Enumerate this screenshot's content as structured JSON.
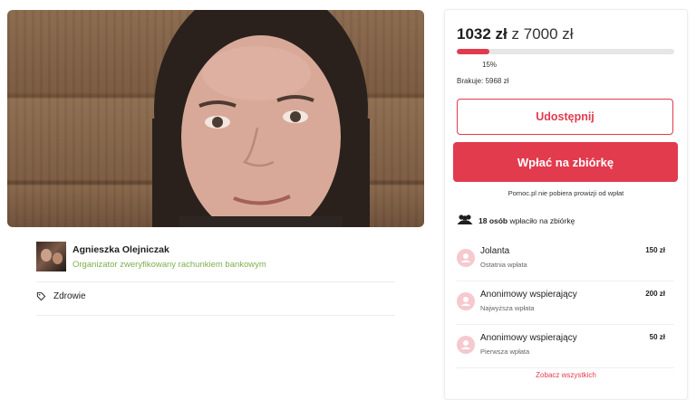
{
  "organizer": {
    "name": "Agnieszka Olejniczak",
    "subtitle": "Organizator zweryfikowany rachunkiem bankowym"
  },
  "category": {
    "label": "Zdrowie",
    "icon": "tag-icon"
  },
  "fundraiser": {
    "raised": "1032 zł",
    "separator": "z",
    "goal": "7000 zł",
    "progress_percent": 15,
    "progress_label": "15%",
    "missing": "Brakuje: 5968 zł"
  },
  "actions": {
    "share_label": "Udostępnij",
    "donate_label": "Wpłać na zbiórkę"
  },
  "fee_note": "Pomoc.pl nie pobiera prowizji od wpłat",
  "donors_summary": {
    "count": "18 osób",
    "suffix": "wpłaciło na zbiórkę"
  },
  "donors": [
    {
      "name": "Jolanta",
      "meta": "Ostatnia wpłata",
      "amount": "150 zł"
    },
    {
      "name": "Anonimowy wspierający",
      "meta": "Najwyższa wpłata",
      "amount": "200 zł"
    },
    {
      "name": "Anonimowy wspierający",
      "meta": "Pierwsza wpłata",
      "amount": "50 zł"
    }
  ],
  "see_all_label": "Zobacz wszystkich",
  "colors": {
    "accent": "#e23b4e",
    "verified": "#7ab04c",
    "avatar": "#f5c9cf"
  }
}
